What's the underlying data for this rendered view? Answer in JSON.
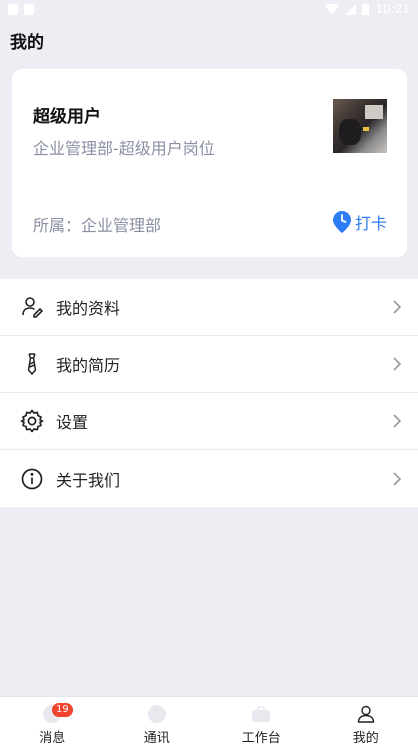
{
  "status_bar": {
    "time": "10:21"
  },
  "header": {
    "title": "我的"
  },
  "profile": {
    "name": "超级用户",
    "position": "企业管理部-超级用户岗位",
    "department_line": "所属：企业管理部",
    "clock_in_label": "打卡"
  },
  "menu": {
    "items": [
      {
        "label": "我的资料",
        "icon": "profile-edit-icon"
      },
      {
        "label": "我的简历",
        "icon": "tie-icon"
      },
      {
        "label": "设置",
        "icon": "gear-icon"
      },
      {
        "label": "关于我们",
        "icon": "info-icon"
      }
    ]
  },
  "tabs": [
    {
      "label": "消息",
      "badge": "19",
      "icon": "message-icon"
    },
    {
      "label": "通讯",
      "icon": "contacts-icon"
    },
    {
      "label": "工作台",
      "icon": "workbench-icon"
    },
    {
      "label": "我的",
      "icon": "person-icon"
    }
  ],
  "colors": {
    "accent": "#2e7cf6",
    "badge": "#f0442e",
    "background": "#eceef4"
  }
}
